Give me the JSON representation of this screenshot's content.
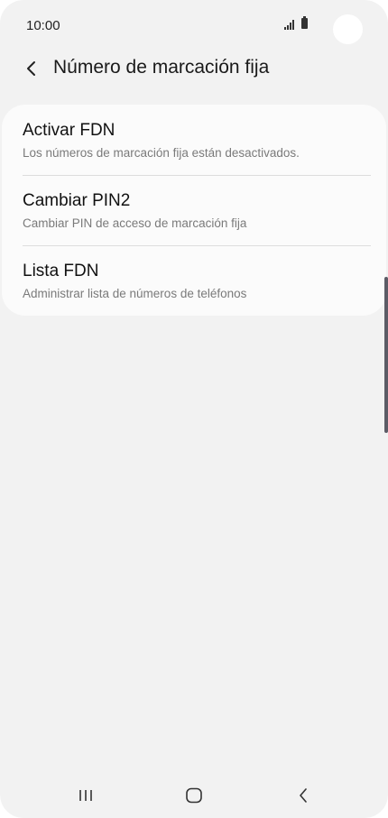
{
  "status_bar": {
    "time": "10:00",
    "icons": [
      "signal-icon",
      "battery-icon"
    ]
  },
  "header": {
    "back_icon": "back-arrow-icon",
    "title": "Número de marcación fija"
  },
  "settings": {
    "items": [
      {
        "title": "Activar FDN",
        "subtitle": "Los números de marcación fija están desactivados."
      },
      {
        "title": "Cambiar PIN2",
        "subtitle": "Cambiar PIN de acceso de marcación fija"
      },
      {
        "title": "Lista FDN",
        "subtitle": "Administrar lista de números de teléfonos"
      }
    ]
  },
  "nav_bar": {
    "buttons": [
      "recent-apps-icon",
      "home-icon",
      "back-icon"
    ]
  },
  "colors": {
    "background": "#f2f2f2",
    "card": "#fbfbfb",
    "subtitle": "#7a7a7a",
    "scrollbar": "#5c5c66"
  }
}
